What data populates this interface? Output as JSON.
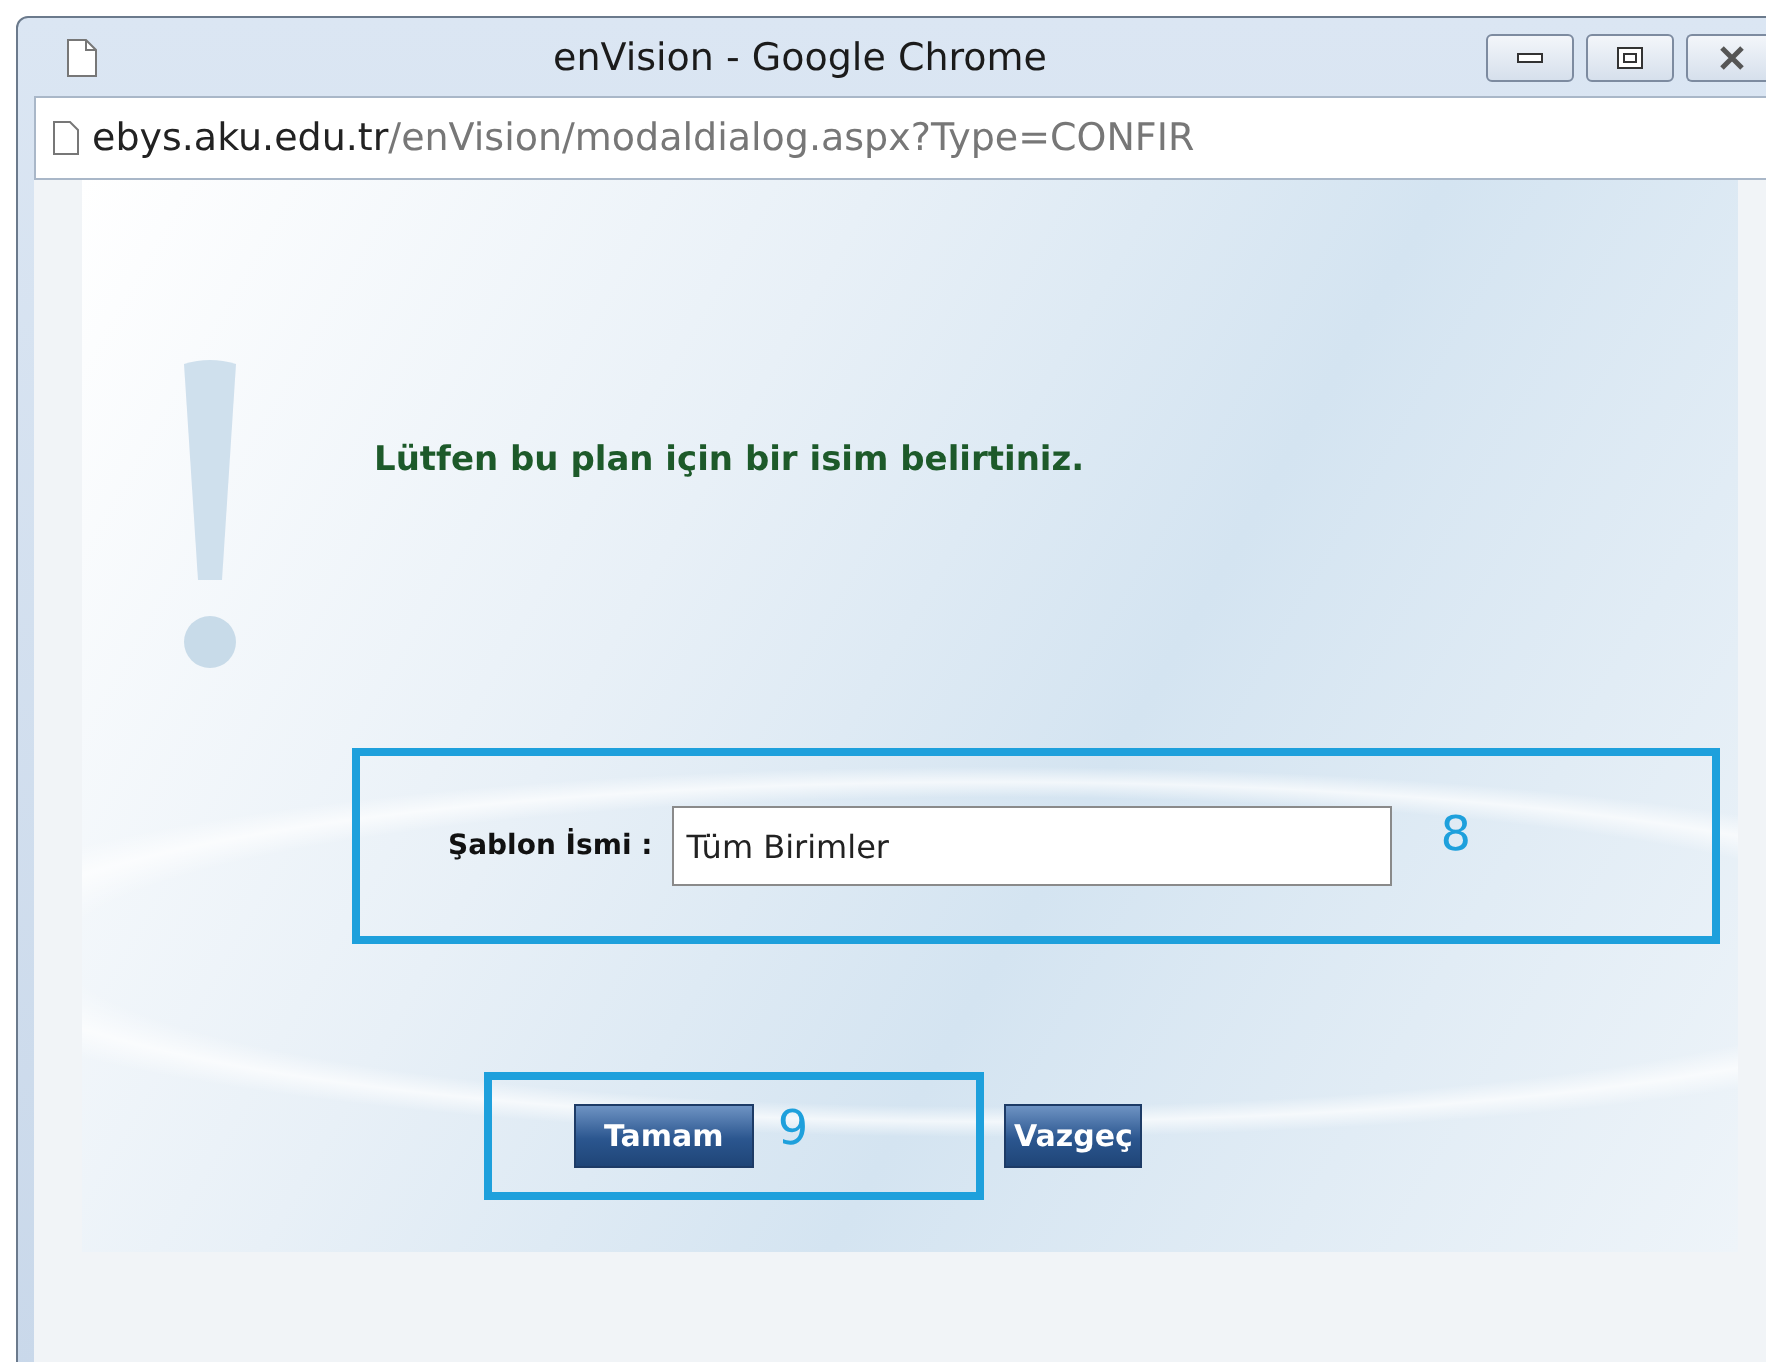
{
  "window": {
    "title": "enVision - Google Chrome"
  },
  "address_bar": {
    "host": "ebys.aku.edu.tr",
    "path": "/enVision/modaldialog.aspx?Type=CONFIR"
  },
  "message": "Lütfen bu plan için bir isim belirtiniz.",
  "field": {
    "label": "Şablon İsmi :",
    "value": "Tüm Birimler",
    "callout": "8"
  },
  "buttons": [
    {
      "label": "Tamam",
      "callout": "9"
    },
    {
      "label": "Vazgeç"
    }
  ]
}
